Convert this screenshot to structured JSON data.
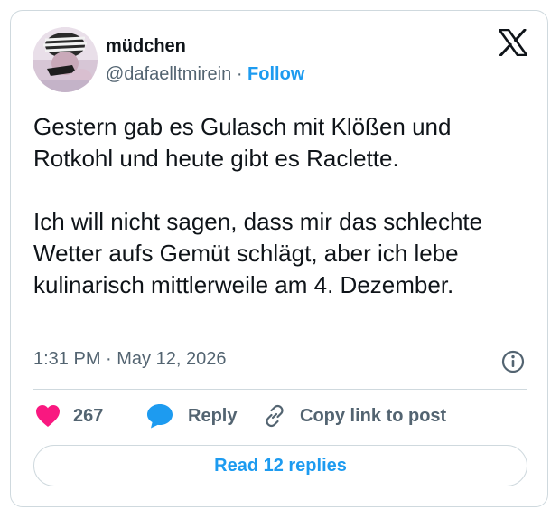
{
  "author": {
    "display_name": "müdchen",
    "handle": "@dafaelltmirein",
    "separator": "·",
    "follow_label": "Follow",
    "avatar_icon": "profile-avatar-photo"
  },
  "brand": {
    "logo_icon": "x-logo-icon"
  },
  "tweet": {
    "text": "Gestern gab es Gulasch mit Klößen und Rotkohl und heute gibt es Raclette.\n\nIch will nicht sagen, dass mir das schlechte Wetter aufs Gemüt schlägt, aber ich lebe kulinarisch mittlerweile am 4. Dezember.",
    "timestamp": "1:31 PM · May 12, 2026"
  },
  "actions": {
    "like_count": "267",
    "reply_label": "Reply",
    "copy_label": "Copy link to post"
  },
  "footer": {
    "read_replies_label": "Read 12 replies"
  },
  "colors": {
    "accent": "#1d9bf0",
    "like": "#f91880",
    "text": "#0f1419",
    "muted": "#536471",
    "border": "#cfd9de"
  }
}
